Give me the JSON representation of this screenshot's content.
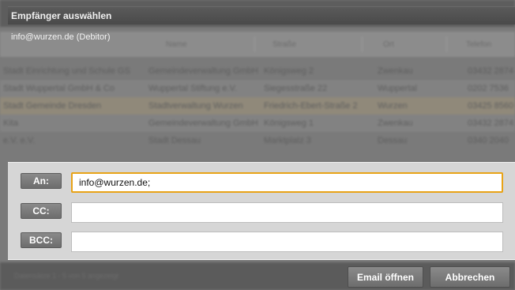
{
  "dialog": {
    "title": "Empfänger auswählen",
    "subtitle": "info@wurzen.de (Debitor)"
  },
  "background": {
    "columns": [
      "Name",
      "Straße",
      "Ort",
      "Telefon"
    ],
    "rows": [
      [
        "Stadt Einrichtung und Schule GS",
        "Gemeindeverwaltung GmbH",
        "Königsweg 2",
        "Zwenkau",
        "03432 2874"
      ],
      [
        "Stadt Wuppertal GmbH & Co",
        "Wuppertal Stiftung e.V.",
        "Siegesstraße 22",
        "Wuppertal",
        "0202 7536"
      ],
      [
        "Stadt Gemeinde Dresden",
        "Stadtverwaltung Wurzen",
        "Friedrich-Ebert-Straße 2",
        "Wurzen",
        "03425 8560"
      ],
      [
        "Kita",
        "Gemeindeverwaltung GmbH",
        "Königsweg 1",
        "Zwenkau",
        "03432 2874"
      ],
      [
        "e.V. e.V.",
        "Stadt Dessau",
        "Marktplatz 3",
        "Dessau",
        "0340 2040"
      ]
    ],
    "footer": "Datensätze 1 - 5 von 5 angezeigt"
  },
  "recipients": {
    "to": {
      "label": "An:",
      "value": "info@wurzen.de;"
    },
    "cc": {
      "label": "CC:",
      "value": ""
    },
    "bcc": {
      "label": "BCC:",
      "value": ""
    }
  },
  "buttons": {
    "open_email": "Email öffnen",
    "cancel": "Abbrechen"
  },
  "colors": {
    "focus_border": "#e8a317",
    "dialog_panel": "#d6d6d6",
    "button": "#7a7a7a"
  }
}
